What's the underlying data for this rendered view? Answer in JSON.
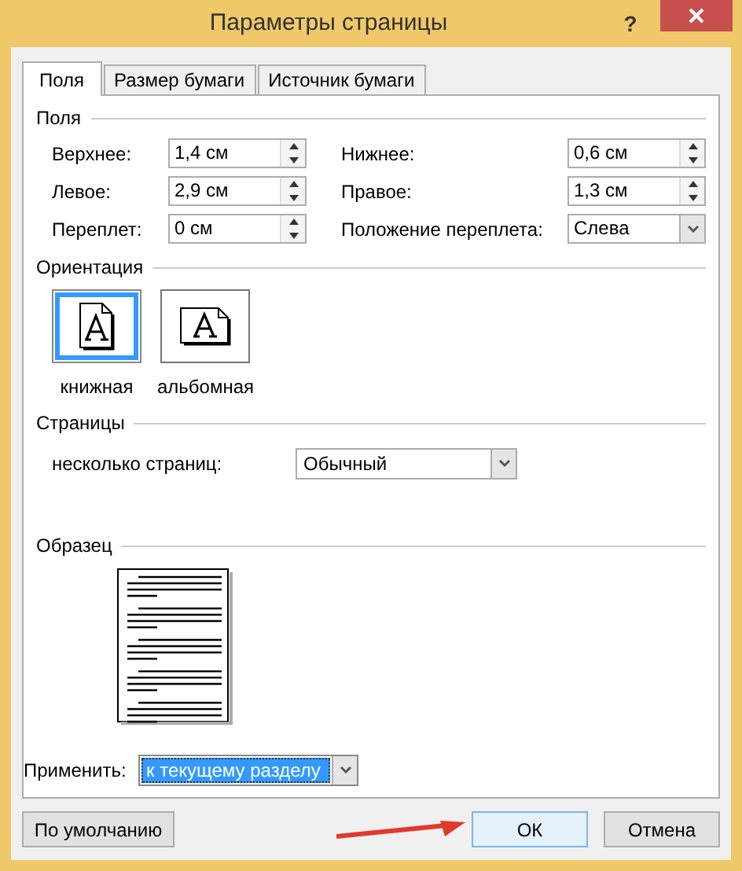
{
  "window": {
    "title": "Параметры страницы",
    "help": "?"
  },
  "tabs": [
    {
      "label": "Поля",
      "selected": true
    },
    {
      "label": "Размер бумаги",
      "selected": false
    },
    {
      "label": "Источник бумаги",
      "selected": false
    }
  ],
  "margins": {
    "title": "Поля",
    "fields": [
      {
        "label": "Верхнее:",
        "value": "1,4 см",
        "kind": "spin"
      },
      {
        "label": "Нижнее:",
        "value": "0,6 см",
        "kind": "spin"
      },
      {
        "label": "Левое:",
        "value": "2,9 см",
        "kind": "spin"
      },
      {
        "label": "Правое:",
        "value": "1,3 см",
        "kind": "spin"
      },
      {
        "label": "Переплет:",
        "value": "0 см",
        "kind": "spin"
      },
      {
        "label": "Положение переплета:",
        "value": "Слева",
        "kind": "select"
      }
    ]
  },
  "orientation": {
    "title": "Ориентация",
    "options": [
      {
        "label": "книжная",
        "kind": "portrait",
        "selected": true
      },
      {
        "label": "альбомная",
        "kind": "landscape",
        "selected": false
      }
    ]
  },
  "pages": {
    "title": "Страницы",
    "label": "несколько страниц:",
    "value": "Обычный"
  },
  "preview": {
    "title": "Образец"
  },
  "apply": {
    "label": "Применить:",
    "value": "к текущему разделу"
  },
  "buttons": [
    {
      "label": "По умолчанию",
      "kind": "default",
      "focused": false
    },
    {
      "label": "ОК",
      "kind": "ok",
      "focused": true
    },
    {
      "label": "Отмена",
      "kind": "cancel",
      "focused": false
    }
  ]
}
